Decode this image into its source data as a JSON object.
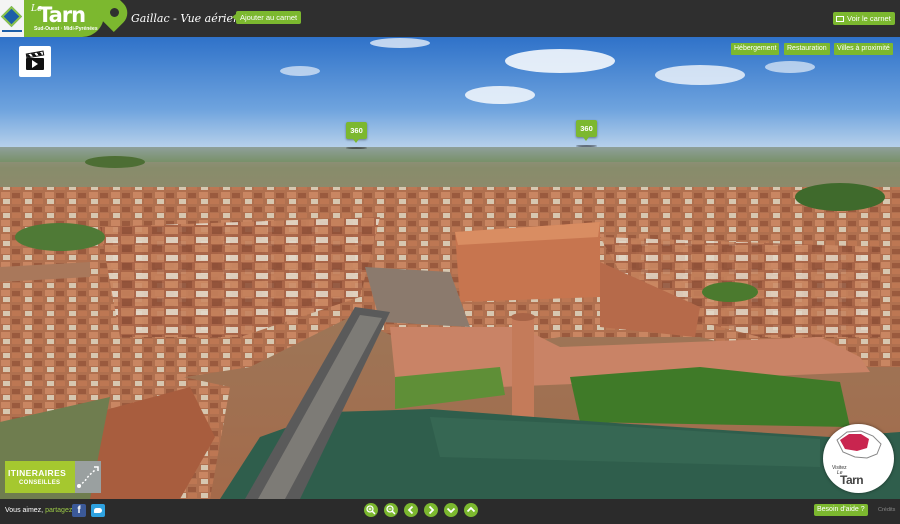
{
  "header": {
    "brand_prefix": "Le",
    "brand_name": "Tarn",
    "brand_tagline": "Sud-Ouest · Midi-Pyrénées",
    "page_title": "Gaillac - Vue aérienne",
    "add_to_notebook": "Ajouter au carnet",
    "view_notebook": "Voir le carnet"
  },
  "categories": {
    "hebergement": "Hébergement",
    "restauration": "Restauration",
    "villes": "Villes à proximité"
  },
  "hotspots": [
    "360",
    "360"
  ],
  "itineraries": {
    "line1": "ITINERAIRES",
    "line2": "CONSEILLES"
  },
  "visit_badge": {
    "line1": "Visitez",
    "line2": "Le",
    "brand": "Tarn"
  },
  "footer": {
    "share_prefix": "Vous aimez,",
    "share_link": "partagez !",
    "help": "Besoin d'aide ?",
    "credits": "Crédits"
  },
  "colors": {
    "accent": "#7cb82f",
    "bar": "#2f2f2f"
  }
}
